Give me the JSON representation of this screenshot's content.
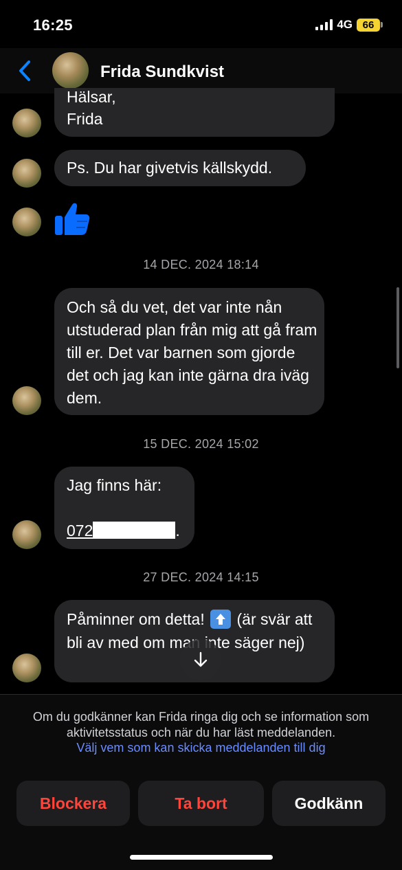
{
  "status_bar": {
    "time": "16:25",
    "network": "4G",
    "battery": "66",
    "battery_color": "#f5d330"
  },
  "header": {
    "contact_name": "Frida Sundkvist"
  },
  "messages": [
    {
      "lines": [
        "Hälsar,",
        "Frida"
      ]
    },
    {
      "text": "Ps. Du har givetvis källskydd."
    },
    {
      "icon": "thumbs-up-icon"
    }
  ],
  "timestamps": [
    "14 DEC. 2024 18:14",
    "15 DEC. 2024 15:02",
    "27 DEC. 2024 14:15"
  ],
  "messages_later": {
    "msg3": "Och så du vet, det var inte nån utstuderad plan från mig att gå fram till er. Det var barnen som gjorde det och jag kan inte gärna dra iväg dem.",
    "msg4_line1": "Jag finns här:",
    "msg4_phone_prefix": "072",
    "msg4_phone_suffix": ".",
    "msg5_before": "Påminner om detta!",
    "msg5_after": "(är svär att bli av med om man inte säger nej)"
  },
  "request": {
    "notice": "Om du godkänner kan Frida ringa dig och se information som aktivitetsstatus och när du har läst meddelanden.",
    "link": "Välj vem som kan skicka meddelanden till dig",
    "link_color": "#6b8cff"
  },
  "buttons": {
    "block": "Blockera",
    "delete": "Ta bort",
    "accept": "Godkänn",
    "danger_color": "#ff453a"
  },
  "colors": {
    "accent": "#0a84ff",
    "bubble": "#262628",
    "background": "#000000"
  }
}
